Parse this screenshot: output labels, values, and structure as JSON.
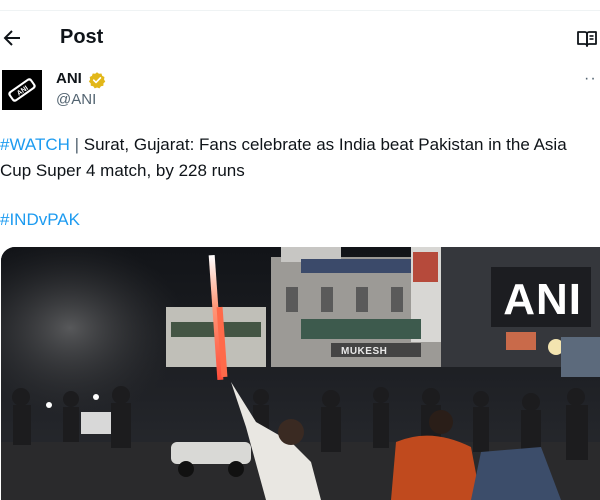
{
  "header": {
    "title": "Post"
  },
  "icons": {
    "back": "arrow-left-icon",
    "reader": "reader-mode-icon",
    "verified": "verified-badge-icon",
    "more": "more-options-icon"
  },
  "author": {
    "name": "ANI",
    "handle": "@ANI",
    "avatar_text": "ANI"
  },
  "more_glyph": "··",
  "tweet": {
    "tag": "#WATCH",
    "separator": " | ",
    "body": "Surat, Gujarat: Fans celebrate as India beat Pakistan in the Asia Cup Super 4 match, by 228 runs",
    "hashtag": "#INDvPAK"
  },
  "media": {
    "watermark": "ANI",
    "shop_sign": "MUKESH"
  },
  "colors": {
    "link": "#1d9bf0",
    "verified": "#e2b719",
    "muted": "#536471"
  }
}
